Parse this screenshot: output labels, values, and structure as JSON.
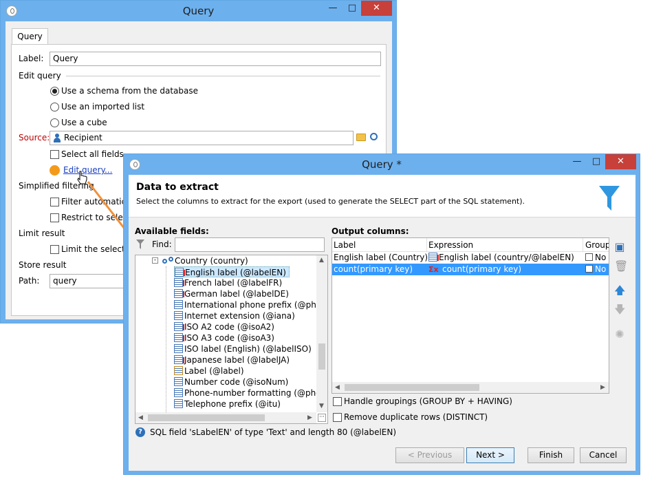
{
  "back_window": {
    "title": "Query",
    "tab": "Query",
    "label_caption": "Label:",
    "label_value": "Query",
    "edit_query_group": "Edit query",
    "options": [
      "Use a schema from the database",
      "Use an imported list",
      "Use a cube"
    ],
    "source_caption": "Source:",
    "source_value": "Recipient",
    "select_all_fields": "Select all fields",
    "edit_query_link": "Edit query...",
    "simplified_filtering": "Simplified filtering",
    "filter_auto": "Filter automatical",
    "restrict": "Restrict to selecte",
    "limit_result": "Limit result",
    "limit_selected": "Limit the selected",
    "store_result": "Store result",
    "path_caption": "Path:",
    "path_value": "query"
  },
  "front_window": {
    "title": "Query *",
    "heading": "Data to extract",
    "description": "Select the columns to extract for the export (used to generate the SELECT part of the SQL statement).",
    "available_fields": "Available fields:",
    "find_caption": "Find:",
    "find_value": "",
    "tree_parent": "Country (country)",
    "tree": [
      "English label (@labelEN)",
      "French label (@labelFR)",
      "German label (@labelDE)",
      "International phone prefix (@phone",
      "Internet extension (@iana)",
      "ISO A2 code (@isoA2)",
      "ISO A3 code (@isoA3)",
      "ISO label (English) (@labelISO)",
      "Japanese label (@labelJA)",
      "Label (@label)",
      "Number code (@isoNum)",
      "Phone-number formatting (@phon",
      "Telephone prefix (@itu)"
    ],
    "output_columns": "Output columns:",
    "col_label": "Label",
    "col_expression": "Expression",
    "col_group": "Group",
    "rows": [
      {
        "label": "English label (Country)",
        "expression": "English label (country/@labelEN)",
        "group": "No"
      },
      {
        "label": "count(primary key)",
        "expression": "count(primary key)",
        "group": "No"
      }
    ],
    "handle_groupings": "Handle groupings (GROUP BY + HAVING)",
    "remove_duplicates": "Remove duplicate rows (DISTINCT)",
    "status": "SQL field 'sLabelEN' of type 'Text' and length 80 (@labelEN)",
    "btn_previous": "< Previous",
    "btn_next": "Next >",
    "btn_finish": "Finish",
    "btn_cancel": "Cancel"
  },
  "colors": {
    "titlebar": "#6db0ee",
    "selection": "#3399ff",
    "arrow": "#f0913a",
    "source_label": "#c00000",
    "link": "#1a3fbf"
  },
  "icons": [
    "app-icon",
    "minimize-icon",
    "maximize-icon",
    "close-icon",
    "funnel-icon",
    "recipient-icon",
    "folder-icon",
    "search-icon",
    "field-icon",
    "link-icon",
    "add-icon",
    "delete-icon",
    "move-up-icon",
    "move-down-icon",
    "help-icon"
  ]
}
